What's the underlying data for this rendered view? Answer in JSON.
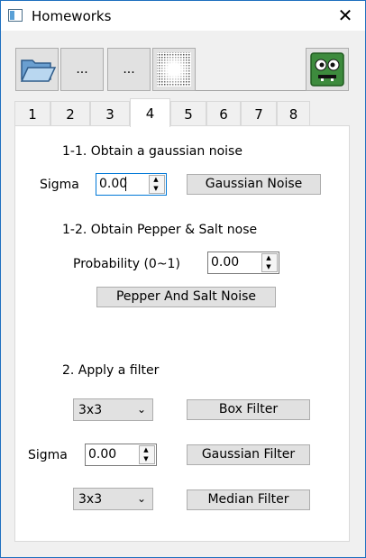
{
  "window": {
    "title": "Homeworks"
  },
  "toolbar": {
    "open_icon": "folder-open-icon",
    "button2_label": "...",
    "button3_label": "...",
    "noise_icon": "noise-image-icon",
    "face_icon": "green-monster-face-icon"
  },
  "tabs": [
    "1",
    "2",
    "3",
    "4",
    "5",
    "6",
    "7",
    "8"
  ],
  "active_tab": "4",
  "section1": {
    "gaussian_title": "1-1. Obtain a gaussian noise",
    "sigma_label": "Sigma",
    "sigma_value": "0.00",
    "gaussian_button": "Gaussian Noise",
    "pepper_title": "1-2. Obtain Pepper & Salt nose",
    "probability_label": "Probability (0~1)",
    "probability_value": "0.00",
    "pepper_button": "Pepper And Salt Noise"
  },
  "section2": {
    "title": "2. Apply a filter",
    "box_size": "3x3",
    "box_button": "Box Filter",
    "sigma_label": "Sigma",
    "sigma_value": "0.00",
    "gaussian_button": "Gaussian Filter",
    "median_size": "3x3",
    "median_button": "Median Filter"
  },
  "colors": {
    "accent": "#0078d7",
    "window_border": "#1e6fbf",
    "face_green": "#3d8b3d"
  }
}
